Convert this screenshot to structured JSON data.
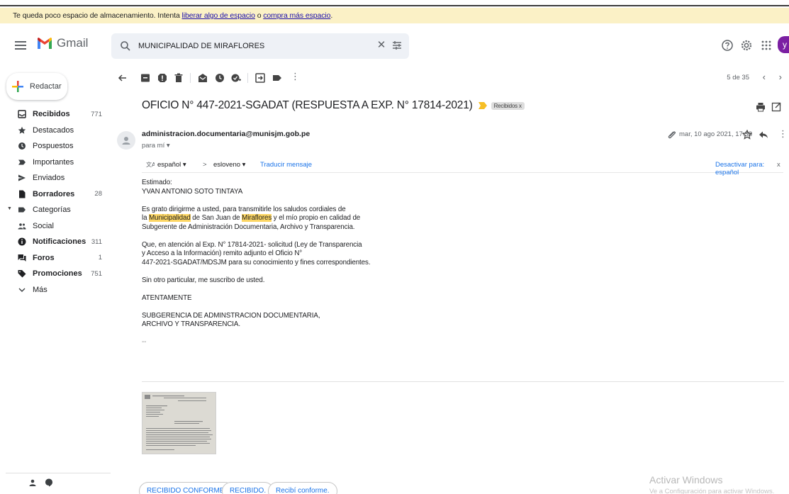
{
  "banner": {
    "text_before": "Te queda poco espacio de almacenamiento. Intenta ",
    "link1": "liberar algo de espacio",
    "text_middle": " o ",
    "link2": "compra más espacio",
    "text_after": "."
  },
  "header": {
    "app_name": "Gmail",
    "search_value": "MUNICIPALIDAD DE MIRAFLORES",
    "avatar_letter": "y"
  },
  "sidebar": {
    "compose_label": "Redactar",
    "items": [
      {
        "label": "Recibidos",
        "count": "771",
        "bold": true,
        "icon": "inbox-icon"
      },
      {
        "label": "Destacados",
        "count": "",
        "bold": false,
        "icon": "star-icon"
      },
      {
        "label": "Pospuestos",
        "count": "",
        "bold": false,
        "icon": "clock-icon"
      },
      {
        "label": "Importantes",
        "count": "",
        "bold": false,
        "icon": "important-icon"
      },
      {
        "label": "Enviados",
        "count": "",
        "bold": false,
        "icon": "send-icon"
      },
      {
        "label": "Borradores",
        "count": "28",
        "bold": true,
        "icon": "draft-icon"
      },
      {
        "label": "Categorías",
        "count": "",
        "bold": false,
        "icon": "label-icon"
      },
      {
        "label": "Social",
        "count": "",
        "bold": false,
        "icon": "people-icon"
      },
      {
        "label": "Notificaciones",
        "count": "311",
        "bold": true,
        "icon": "info-icon"
      },
      {
        "label": "Foros",
        "count": "1",
        "bold": true,
        "icon": "forum-icon"
      },
      {
        "label": "Promociones",
        "count": "751",
        "bold": true,
        "icon": "tag-icon"
      },
      {
        "label": "Más",
        "count": "",
        "bold": false,
        "icon": "chevron-down-icon"
      }
    ]
  },
  "toolbar": {
    "pager_text": "5 de 35"
  },
  "message": {
    "subject": "OFICIO N° 447-2021-SGADAT (RESPUESTA A EXP. N° 17814-2021)",
    "label_chip": "Recibidos x",
    "sender": "administracion.documentaria@munisjm.gob.pe",
    "to_me": "para mí ▾",
    "date": "mar, 10 ago 2021, 17:38",
    "translate": {
      "from_lang": "español ▾",
      "arrow": ">",
      "to_lang": "esloveno ▾",
      "translate_link": "Traducir mensaje",
      "disable_link": "Desactivar para: español",
      "disable_x": "x"
    },
    "body": {
      "greeting": "Estimado:",
      "name": "YVAN ANTONIO SOTO TINTAYA",
      "p1_line1": "Es grato dirigirme a usted, para transmitirle los saludos cordiales de",
      "p1_l2_a": "la ",
      "p1_l2_hl1": "Municipalidad",
      "p1_l2_b": " de San Juan de ",
      "p1_l2_hl2": "Miraflores",
      "p1_l2_c": " y el mío propio en calidad de",
      "p1_line3": "Subgerente de Administración Documentaria, Archivo y Transparencia.",
      "p2_line1": "Que, en atención al Exp. N° 17814-2021- solicitud (Ley de Transparencia",
      "p2_line2": "y Acceso a la Información) remito adjunto el Oficio N°",
      "p2_line3": "447-2021-SGADAT/MDSJM para su conocimiento y fines correspondientes.",
      "p3": "Sin otro particular, me suscribo de usted.",
      "p4": "ATENTAMENTE",
      "sig1": "SUBGERENCIA DE ADMINSTRACION DOCUMENTARIA,",
      "sig2": "ARCHIVO Y TRANSPARENCIA.",
      "dash": "--"
    }
  },
  "quick_replies": [
    "RECIBIDO CONFORME.",
    "RECIBIDO.",
    "Recibí conforme."
  ],
  "watermark": {
    "line1": "Activar Windows",
    "line2": "Ve a Configuración para activar Windows."
  },
  "colors": {
    "banner_bg": "#fbf1c6",
    "highlight": "#fcd664",
    "link": "#1a73e8",
    "avatar": "#7b1fa2"
  }
}
